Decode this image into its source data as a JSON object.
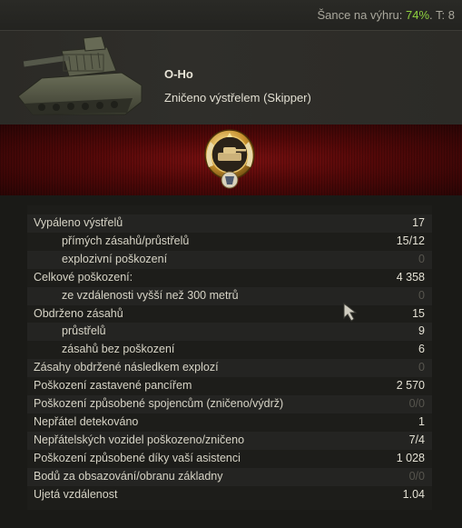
{
  "top": {
    "chance_label": "Šance na výhru:",
    "chance_value": "74%",
    "tier": ". T: 8"
  },
  "vehicle": {
    "name": "O-Ho",
    "status": "Zničeno výstřelem (Skipper)"
  },
  "colors": {
    "banner": "#6a0c0c",
    "positive": "#8fd13f"
  },
  "medal_icon": "tank-medal-icon",
  "stats": [
    {
      "label": "Vypáleno výstřelů",
      "value": "17",
      "type": "main",
      "zero": false
    },
    {
      "label": "přímých zásahů/průstřelů",
      "value": "15/12",
      "type": "sub",
      "zero": false
    },
    {
      "label": "explozivní poškození",
      "value": "0",
      "type": "sub",
      "zero": true
    },
    {
      "label": "Celkové poškození:",
      "value": "4 358",
      "type": "main",
      "zero": false
    },
    {
      "label": "ze vzdálenosti vyšší než 300 metrů",
      "value": "0",
      "type": "sub",
      "zero": true
    },
    {
      "label": "Obdrženo zásahů",
      "value": "15",
      "type": "main",
      "zero": false
    },
    {
      "label": "průstřelů",
      "value": "9",
      "type": "sub",
      "zero": false
    },
    {
      "label": "zásahů bez poškození",
      "value": "6",
      "type": "sub",
      "zero": false
    },
    {
      "label": "Zásahy obdržené následkem explozí",
      "value": "0",
      "type": "main",
      "zero": true
    },
    {
      "label": "Poškození zastavené pancířem",
      "value": "2 570",
      "type": "main",
      "zero": false
    },
    {
      "label": "Poškození způsobené spojencům (zničeno/výdrž)",
      "value": "0/0",
      "type": "main",
      "zero": true
    },
    {
      "label": "Nepřátel detekováno",
      "value": "1",
      "type": "main",
      "zero": false
    },
    {
      "label": "Nepřátelských vozidel poškozeno/zničeno",
      "value": "7/4",
      "type": "main",
      "zero": false
    },
    {
      "label": "Poškození způsobené díky vaší asistenci",
      "value": "1 028",
      "type": "main",
      "zero": false
    },
    {
      "label": "Bodů za obsazování/obranu základny",
      "value": "0/0",
      "type": "main",
      "zero": true
    },
    {
      "label": "Ujetá vzdálenost",
      "value": "1.04",
      "type": "main",
      "zero": false
    }
  ]
}
